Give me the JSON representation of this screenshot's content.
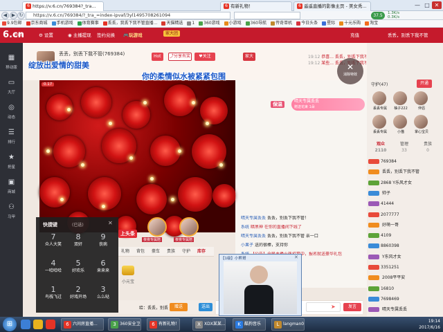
{
  "browser": {
    "tabs": [
      {
        "label": "https://v.6.cn/769384?_tra...",
        "active": true
      },
      {
        "label": "有新礼物！"
      },
      {
        "label": "遥遥直播的影像主页 - 美女秀..."
      }
    ],
    "url": "https://v.6.cn/769384/?_tra_=index-ipvaf/3yl1495708261094",
    "search_placeholder": "",
    "win": {
      "min": "—",
      "max": "□",
      "close": "✕"
    },
    "nav": {
      "back": "◀",
      "forward": "▶",
      "refresh": "↻"
    },
    "bookmarks": [
      "9.9包邮",
      "京东商城",
      "手机游戏",
      "体育赛事",
      "丢丢，我丢下我不管直播...",
      "天猫精选",
      "1",
      "360游戏",
      "小游戏",
      "360导航",
      "传奇单机",
      "今日头条",
      "星际",
      "十元乐购",
      "淘宝"
    ],
    "weather": "37.5",
    "net_up": "1.3K/s",
    "net_down": "0.3K/s"
  },
  "site": {
    "logo": "6.cn",
    "logo_sub": "六间房",
    "nav": [
      "设置",
      "主播提现",
      "签约兑换",
      "玩游戏"
    ],
    "badge": "家大团",
    "user_right": [
      "充值",
      "丢丢，别丢下我不管"
    ]
  },
  "rail": [
    {
      "icon": "▦",
      "label": "移动版"
    },
    {
      "icon": "▭",
      "label": "大厅"
    },
    {
      "icon": "◎",
      "label": "动态"
    },
    {
      "icon": "☰",
      "label": "排行"
    },
    {
      "icon": "★",
      "label": "抢星"
    },
    {
      "icon": "▣",
      "label": "商城"
    },
    {
      "icon": "⚇",
      "label": "马甲"
    }
  ],
  "anchor": {
    "name": "丢丢，别丢下我不管",
    "room_id": "(769384)",
    "fans": "2083",
    "hot_label": "Hot",
    "share": "分享有奖",
    "follow": "关注",
    "fan_club": "家大"
  },
  "overlay": {
    "left_title": "绽放出爱情的甜美",
    "main_title": "你的柔情似水被紧紧包围",
    "protect": "保温",
    "gift_pill_name": "晴天专属丢丢",
    "gift_pill_sub": "赠送花束 1朵",
    "close": "消除特效",
    "close_icon": "✕",
    "top_label": "上头条",
    "guard_label": "夜夜专属陪",
    "small_tag": "0.17"
  },
  "top_chat": [
    {
      "time": "19:12",
      "text": "恭喜... 丢丢，别丢下我不管 出中奖了获得爱心礼包"
    },
    {
      "time": "19:12",
      "text": "某些... 丢丢，别丢下我不管 向主播赠送了 1个 声乐之魂"
    }
  ],
  "chat": [
    {
      "user": "晴天专属丢丢",
      "text": "丢丢，别丢下我不管！"
    },
    {
      "user": "系统",
      "text": "暗黑神 在你的直播间下线了"
    },
    {
      "user": "晴天专属丢丢",
      "text": "丢丢，别丢下我不管 亲一口"
    },
    {
      "user": "小果子",
      "text": "送的很棒，支持你"
    },
    {
      "user": "系统",
      "text": "【公告】全民主播火热招募中，报名就送豪华礼包"
    },
    {
      "user": "晴天专属丢丢",
      "text": "你就是我的唯一"
    },
    {
      "user": "小影知",
      "text": "跟我们一起玩"
    }
  ],
  "quick": {
    "title": "快捷键",
    "subtitle": "(已选)",
    "close": "✕",
    "items": [
      {
        "key": "7",
        "label": "众人大笑"
      },
      {
        "key": "8",
        "label": "双奸"
      },
      {
        "key": "9",
        "label": "丧病"
      },
      {
        "key": "4",
        "label": "一哈哈哈"
      },
      {
        "key": "5",
        "label": "好欢乐"
      },
      {
        "key": "6",
        "label": "来来来"
      },
      {
        "key": "1",
        "label": "鸟栈飞过"
      },
      {
        "key": "2",
        "label": "好戏开场"
      },
      {
        "key": "3",
        "label": "么么哒"
      }
    ]
  },
  "gift_tabs": [
    "礼物",
    "背包",
    "豪车",
    "贵族",
    "守护",
    "库存"
  ],
  "gift_item": "小元宝",
  "send": {
    "target_label": "给：",
    "target": "丢丢，别丢",
    "gift_button": "赠送",
    "send_button": "送出",
    "chat_button": "发言",
    "count_button": "赠送"
  },
  "right": {
    "guard_title": "守护(47)",
    "open_guard": "开通",
    "guards": [
      {
        "name": "丢丢专属",
        "tag": "守"
      },
      {
        "name": "柚子222",
        "tag": "守"
      },
      {
        "name": "伴侣",
        "tag": "守"
      },
      {
        "name": "丢丢专属",
        "tag": "守"
      },
      {
        "name": "小猫",
        "tag": "守"
      },
      {
        "name": "掌心宝贝",
        "tag": "守"
      }
    ],
    "tabs": [
      {
        "label": "观众",
        "count": "2110"
      },
      {
        "label": "管理",
        "count": "33"
      },
      {
        "label": "贵族",
        "count": "0"
      }
    ],
    "users": [
      {
        "id": "769384",
        "name": ""
      },
      {
        "id": "",
        "name": "丢丢，别丢下我不管"
      },
      {
        "id": "2868",
        "name": "Y乐风才女"
      },
      {
        "id": "",
        "name": "帅子"
      },
      {
        "id": "41444",
        "name": ""
      },
      {
        "id": "2077777",
        "name": ""
      },
      {
        "id": "",
        "name": "好萌一哥"
      },
      {
        "id": "4109",
        "name": ""
      },
      {
        "id": "8860398",
        "name": ""
      },
      {
        "id": "",
        "name": "Y东风才女"
      },
      {
        "id": "3351251",
        "name": ""
      },
      {
        "id": "",
        "name": "2008平平安"
      },
      {
        "id": "16810",
        "name": ""
      },
      {
        "id": "7698469",
        "name": ""
      },
      {
        "id": "",
        "name": "晴天专属丢丢"
      }
    ]
  },
  "popup": {
    "title": "【1级】小熊哥",
    "close": "✕"
  },
  "taskbar": {
    "start": "⊞",
    "buttons": [
      {
        "label": "六间房直播...",
        "color": "#e43326",
        "icon": "6"
      },
      {
        "label": "360安全卫...",
        "color": "#4aa24a",
        "icon": "3"
      },
      {
        "label": "有新礼物！...",
        "color": "#e43326",
        "icon": "6"
      },
      {
        "label": "XDX某某...",
        "color": "#888888",
        "icon": "X"
      },
      {
        "label": "酷狗音乐",
        "color": "#2a7ae0",
        "icon": "K"
      },
      {
        "label": "langman0...",
        "color": "#c0892e",
        "icon": "L"
      }
    ],
    "time": "19:14",
    "date": "2017/6/16"
  }
}
